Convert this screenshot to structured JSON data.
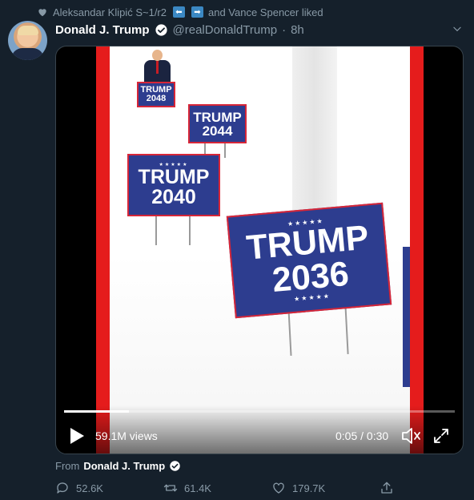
{
  "social_context": {
    "user1": "Aleksandar Klipić S~1/r2",
    "user1_icons": [
      "⬅",
      "➡"
    ],
    "connector": "and Vance Spencer liked"
  },
  "tweet": {
    "name": "Donald J. Trump",
    "handle": "@realDonaldTrump",
    "separator": "·",
    "time": "8h"
  },
  "video": {
    "signs": [
      {
        "line1": "TRUMP",
        "line2": "2048"
      },
      {
        "line1": "TRUMP",
        "line2": "2044"
      },
      {
        "line1": "TRUMP",
        "line2": "2040"
      },
      {
        "line1": "TRUMP",
        "line2": "2036"
      }
    ],
    "views": "59.1M views",
    "time": "0:05 / 0:30",
    "progress": 0.167
  },
  "source": {
    "label": "From",
    "name": "Donald J. Trump"
  },
  "actions": {
    "replies": "52.6K",
    "retweets": "61.4K",
    "likes": "179.7K"
  },
  "colors": {
    "background": "#15202b",
    "muted": "#8899a6",
    "accent": "#1da1f2",
    "sign_blue": "#2d3d8f",
    "sign_red": "#d72638"
  }
}
